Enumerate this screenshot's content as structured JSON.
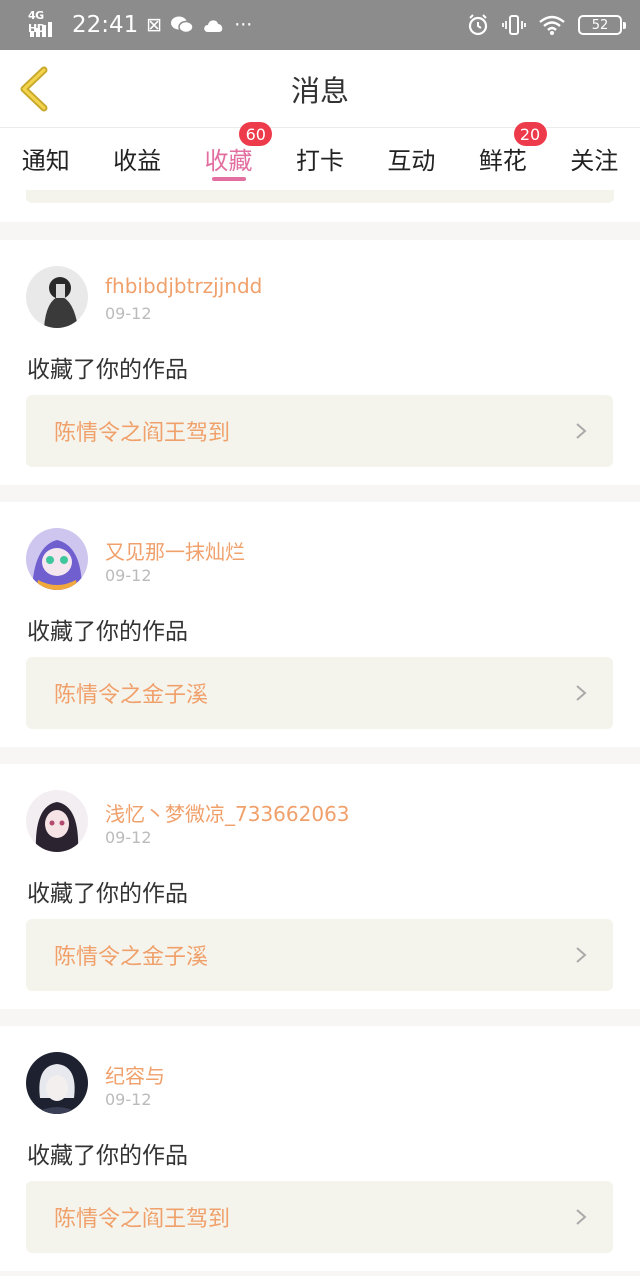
{
  "status_bar": {
    "network": "4G HD",
    "time": "22:41",
    "battery": "52"
  },
  "header": {
    "title": "消息"
  },
  "tabs": [
    {
      "label": "通知",
      "badge": ""
    },
    {
      "label": "收益",
      "badge": ""
    },
    {
      "label": "收藏",
      "badge": "60",
      "active": true
    },
    {
      "label": "打卡",
      "badge": ""
    },
    {
      "label": "互动",
      "badge": ""
    },
    {
      "label": "鲜花",
      "badge": "20"
    },
    {
      "label": "关注",
      "badge": ""
    }
  ],
  "notifications": [
    {
      "username": "fhbibdjbtrzjjndd",
      "date": "09-12",
      "action": "收藏了你的作品",
      "work_title": "陈情令之阎王驾到"
    },
    {
      "username": "又见那一抹灿烂",
      "date": "09-12",
      "action": "收藏了你的作品",
      "work_title": "陈情令之金子溪"
    },
    {
      "username": "浅忆丶梦微凉_733662063",
      "date": "09-12",
      "action": "收藏了你的作品",
      "work_title": "陈情令之金子溪"
    },
    {
      "username": "纪容与",
      "date": "09-12",
      "action": "收藏了你的作品",
      "work_title": "陈情令之阎王驾到"
    }
  ],
  "colors": {
    "accent_pink": "#e26fa0",
    "badge_red": "#ee3b4b",
    "username_orange": "#f0a06b",
    "work_bg": "#f5f4ec"
  }
}
